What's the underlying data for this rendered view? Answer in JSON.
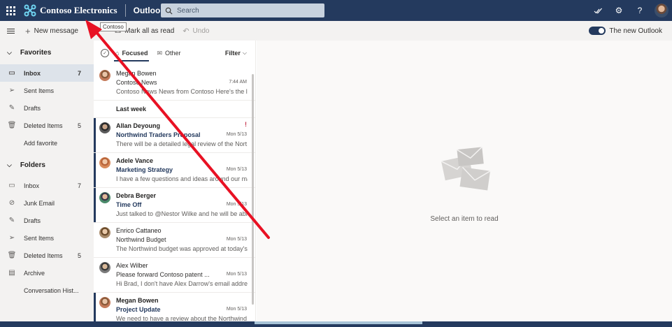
{
  "header": {
    "brand": "Contoso Electronics",
    "app_name": "Outlook",
    "search_placeholder": "Search",
    "tooltip": "Contoso"
  },
  "commandbar": {
    "new_message": "New message",
    "mark_all_read": "Mark all as read",
    "undo": "Undo",
    "toggle_label": "The new Outlook"
  },
  "nav": {
    "favorites_label": "Favorites",
    "favorites": [
      {
        "label": "Inbox",
        "count": "7",
        "icon": "inbox-icon"
      },
      {
        "label": "Sent Items",
        "count": "",
        "icon": "send-icon"
      },
      {
        "label": "Drafts",
        "count": "",
        "icon": "pencil-icon"
      },
      {
        "label": "Deleted Items",
        "count": "5",
        "icon": "trash-icon"
      }
    ],
    "add_favorite": "Add favorite",
    "folders_label": "Folders",
    "folders": [
      {
        "label": "Inbox",
        "count": "7",
        "icon": "inbox-icon"
      },
      {
        "label": "Junk Email",
        "count": "",
        "icon": "block-icon"
      },
      {
        "label": "Drafts",
        "count": "",
        "icon": "pencil-icon"
      },
      {
        "label": "Sent Items",
        "count": "",
        "icon": "send-icon"
      },
      {
        "label": "Deleted Items",
        "count": "5",
        "icon": "trash-icon"
      },
      {
        "label": "Archive",
        "count": "",
        "icon": "archive-icon"
      },
      {
        "label": "Conversation Hist...",
        "count": "",
        "icon": ""
      }
    ]
  },
  "list": {
    "tab_focused": "Focused",
    "tab_other": "Other",
    "filter": "Filter",
    "group_last_week": "Last week",
    "top_message": {
      "sender": "Megan Bowen",
      "subject": "Contoso News",
      "preview": "Contoso News News from Contoso Here's the l...",
      "time": "7:44 AM"
    },
    "messages": [
      {
        "sender": "Allan Deyoung",
        "subject": "Northwind Traders Proposal",
        "preview": "There will be a detailed legal review of the Nort...",
        "time": "Mon 5/13",
        "flag": "!"
      },
      {
        "sender": "Adele Vance",
        "subject": "Marketing Strategy",
        "preview": "I have a few questions and ideas around our ma...",
        "time": "Mon 5/13",
        "flag": ""
      },
      {
        "sender": "Debra Berger",
        "subject": "Time Off",
        "preview": "Just talked to @Nestor Wilke and he will be able...",
        "time": "Mon 5/13",
        "flag": ""
      },
      {
        "sender": "Enrico Cattaneo",
        "subject": "Northwind Budget",
        "preview": "The Northwind budget was approved at today's...",
        "time": "Mon 5/13",
        "flag": ""
      },
      {
        "sender": "Alex Wilber",
        "subject": "Please forward Contoso patent ...",
        "preview": "Hi Brad, I don't have Alex Darrow's email addres...",
        "time": "Mon 5/13",
        "flag": ""
      },
      {
        "sender": "Megan Bowen",
        "subject": "Project Update",
        "preview": "We need to have a review about the Northwind ...",
        "time": "Mon 5/13",
        "flag": ""
      }
    ]
  },
  "reading": {
    "empty_text": "Select an item to read"
  },
  "colors": {
    "header": "#243a5e",
    "accent": "#243a5e",
    "arrow": "#e81123"
  }
}
